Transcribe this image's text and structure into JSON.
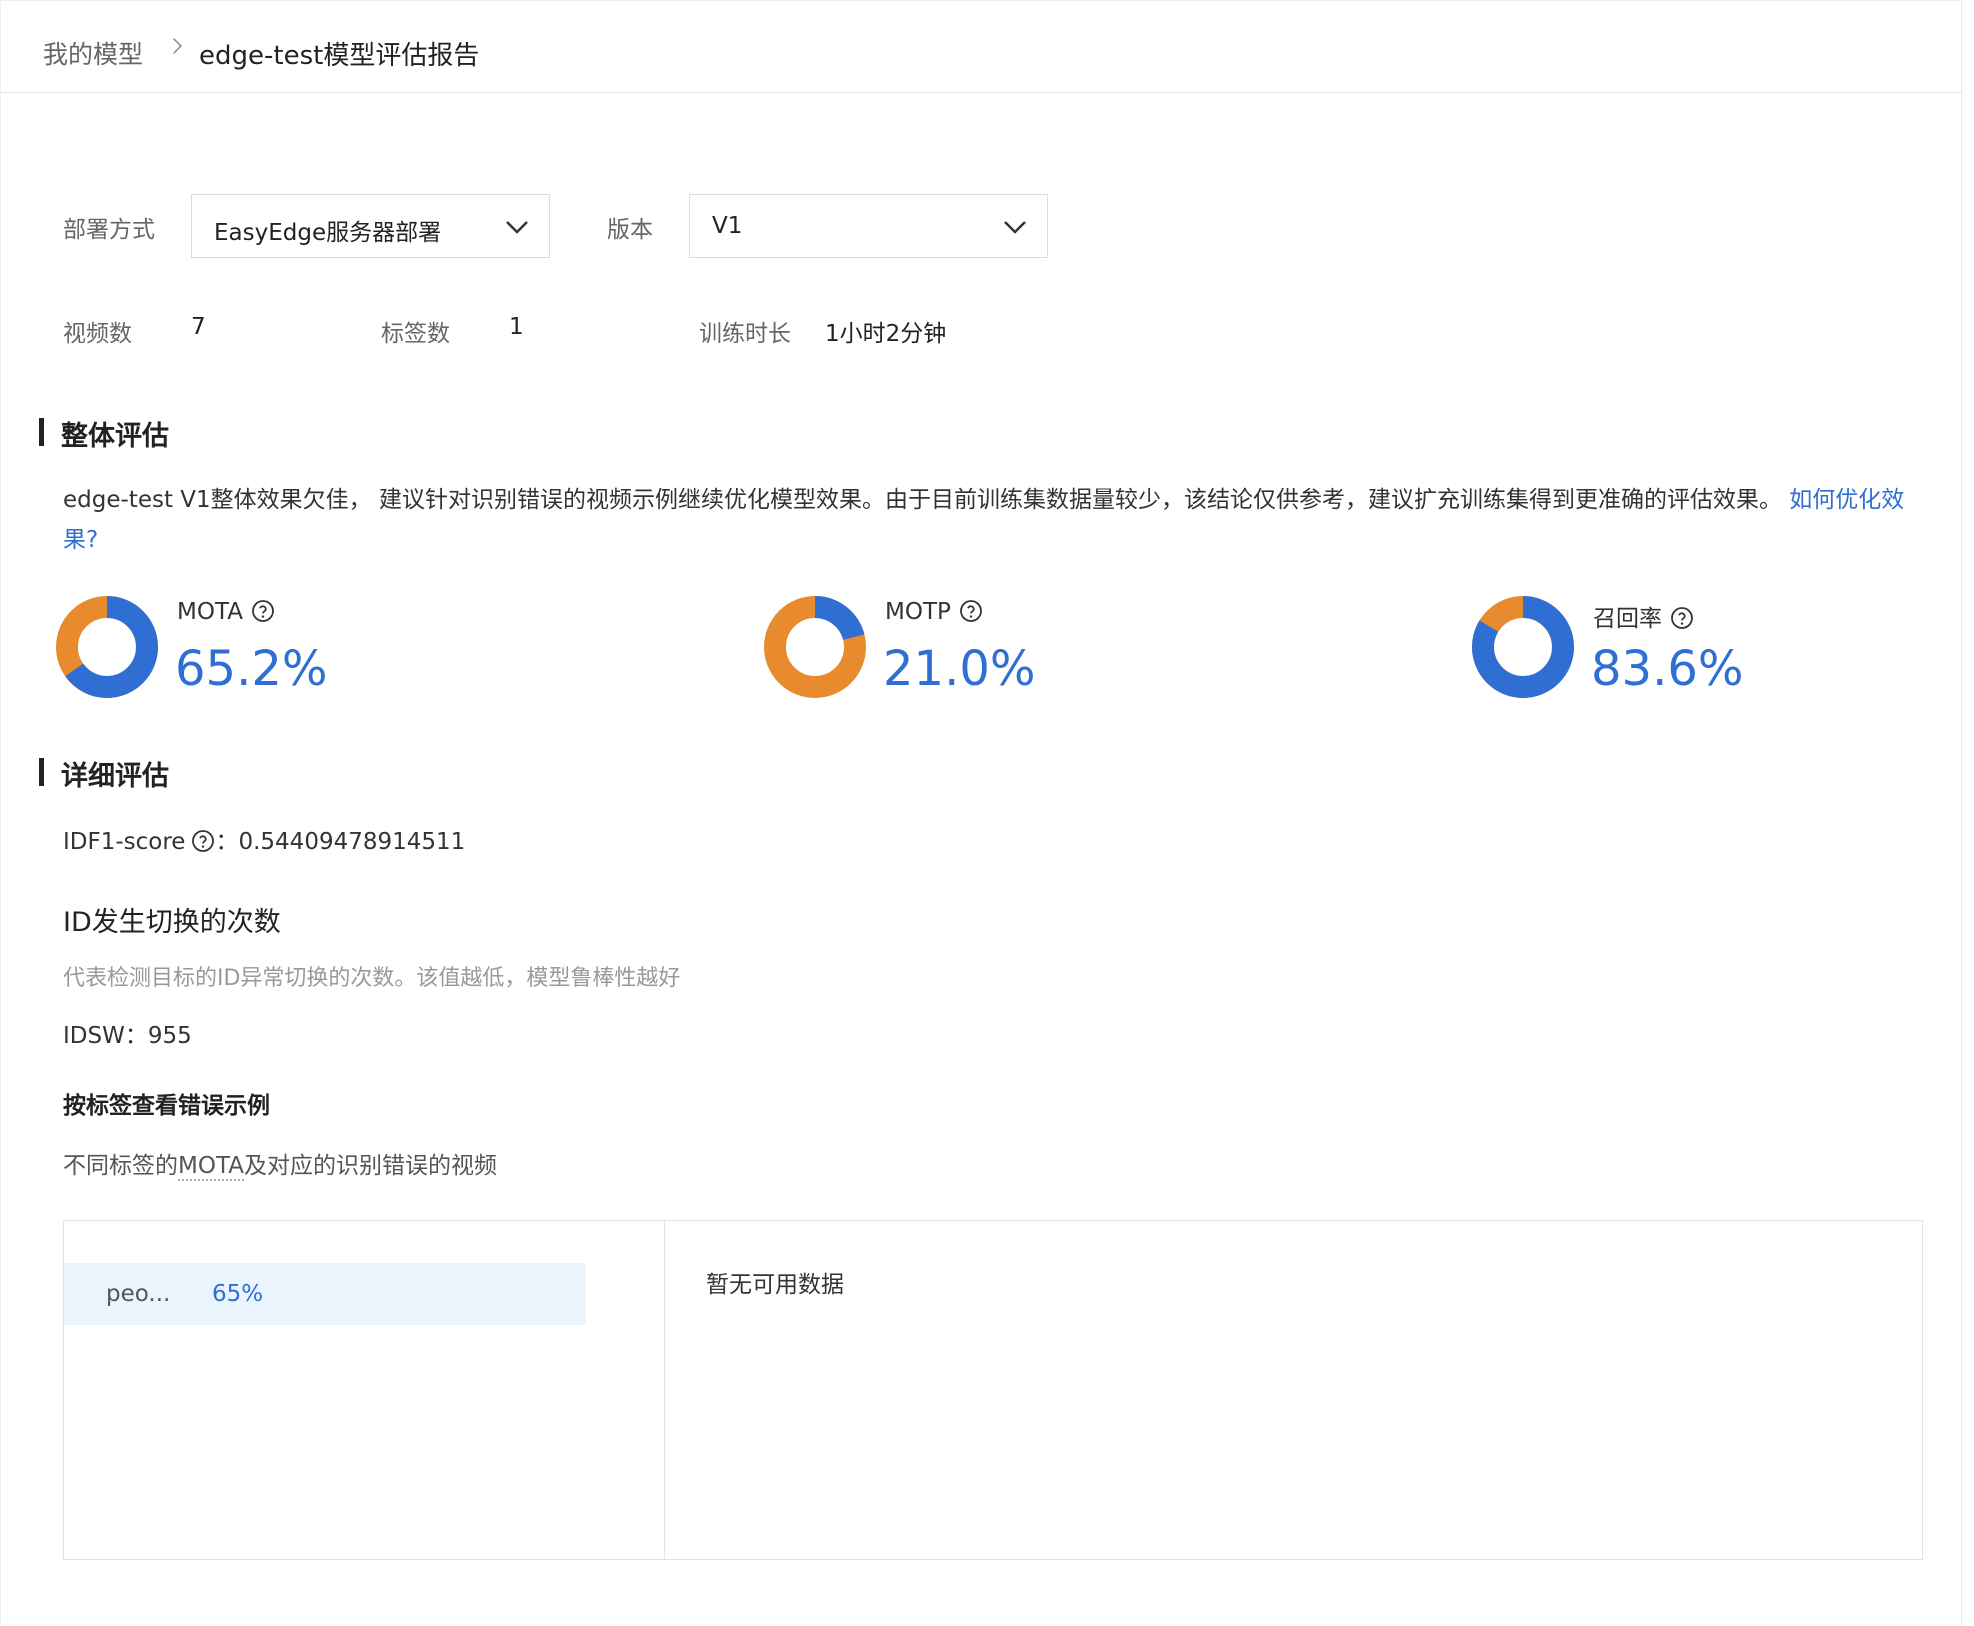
{
  "breadcrumb": {
    "home": "我的模型",
    "separator": ">",
    "current": "edge-test模型评估报告"
  },
  "filters": {
    "deploy_label": "部署方式",
    "deploy_value": "EasyEdge服务器部署",
    "version_label": "版本",
    "version_value": "V1"
  },
  "stats": {
    "videos_label": "视频数",
    "videos_value": "7",
    "tags_label": "标签数",
    "tags_value": "1",
    "duration_label": "训练时长",
    "duration_value": "1小时2分钟"
  },
  "overall": {
    "title": "整体评估",
    "summary_text": "edge-test V1整体效果欠佳， 建议针对识别错误的视频示例继续优化模型效果。由于目前训练集数据量较少，该结论仅供参考，建议扩充训练集得到更准确的评估效果。 ",
    "summary_link": "如何优化效果?"
  },
  "metrics": [
    {
      "name": "MOTA",
      "value_text": "65.2%",
      "fraction": 0.652
    },
    {
      "name": "MOTP",
      "value_text": "21.0%",
      "fraction": 0.21
    },
    {
      "name": "召回率",
      "value_text": "83.6%",
      "fraction": 0.836
    }
  ],
  "colors": {
    "primary": "#2f6fd4",
    "secondary": "#e88b2e",
    "row_highlight": "#eaf4fd"
  },
  "detail": {
    "title": "详细评估",
    "idf1_label": "IDF1-score",
    "idf1_sep": "：",
    "idf1_value": "0.54409478914511",
    "idsw_title": "ID发生切换的次数",
    "idsw_desc": "代表检测目标的ID异常切换的次数。该值越低，模型鲁棒性越好",
    "idsw_label": "IDSW：",
    "idsw_value": "955",
    "by_tag_title": "按标签查看错误示例",
    "by_tag_desc_pre": "不同标签的",
    "by_tag_desc_term": "MOTA",
    "by_tag_desc_post": "及对应的识别错误的视频",
    "tags": [
      {
        "name": "peo...",
        "value": "65%"
      }
    ],
    "empty_text": "暂无可用数据"
  },
  "icons": {
    "help": "question-circle-icon",
    "chevron": "chevron-down-icon",
    "breadcrumb_sep": "chevron-right-icon"
  }
}
